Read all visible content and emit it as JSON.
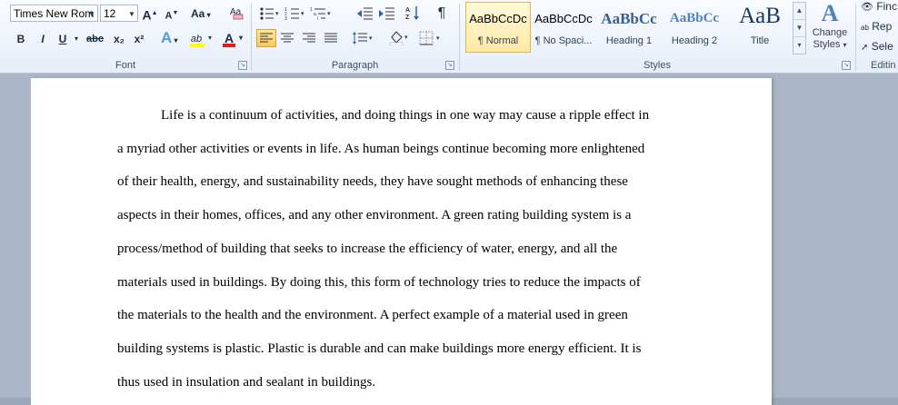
{
  "font": {
    "name": "Times New Rom",
    "size": "12",
    "grow_label": "A",
    "shrink_label": "A",
    "case_label": "Aa",
    "bold": "B",
    "italic": "I",
    "underline": "U",
    "strike": "abc",
    "subscript": "x₂",
    "superscript": "x²",
    "effects": "A",
    "highlight": "ab",
    "color": "A",
    "group_label": "Font"
  },
  "paragraph": {
    "group_label": "Paragraph",
    "pilcrow": "¶"
  },
  "styles": {
    "group_label": "Styles",
    "items": [
      {
        "sample": "AaBbCcDc",
        "name": "¶ Normal"
      },
      {
        "sample": "AaBbCcDc",
        "name": "¶ No Spaci..."
      },
      {
        "sample": "AaBbCc",
        "name": "Heading 1"
      },
      {
        "sample": "AaBbCc",
        "name": "Heading 2"
      },
      {
        "sample": "AaB",
        "name": "Title"
      }
    ],
    "change_styles_line1": "Change",
    "change_styles_line2": "Styles",
    "change_styles_glyph": "A"
  },
  "editing": {
    "group_label": "Editin",
    "find": "Finc",
    "replace": "Rep",
    "select": "Sele"
  },
  "document": {
    "lines": [
      "Life is a continuum of activities, and doing things in one way may cause a ripple  effect in",
      "a myriad other activities or events in life. As human beings continue becoming more enlightened",
      "of their health, energy, and sustainability  needs, they have sought methods of enhancing these",
      "aspects in their homes, offices, and any other environment.  A green rating building system is a",
      "process/method of building that seeks to increase  the efficiency of water, energy, and all the",
      "materials  used in buildings. By doing this, this form of technology tries to reduce the impacts of",
      "the materials to the health and the environment.  A perfect example of a material used in green",
      "building systems is plastic. Plastic is durable and can make buildings more energy efficient. It is",
      "thus used in insulation  and sealant in buildings."
    ]
  }
}
